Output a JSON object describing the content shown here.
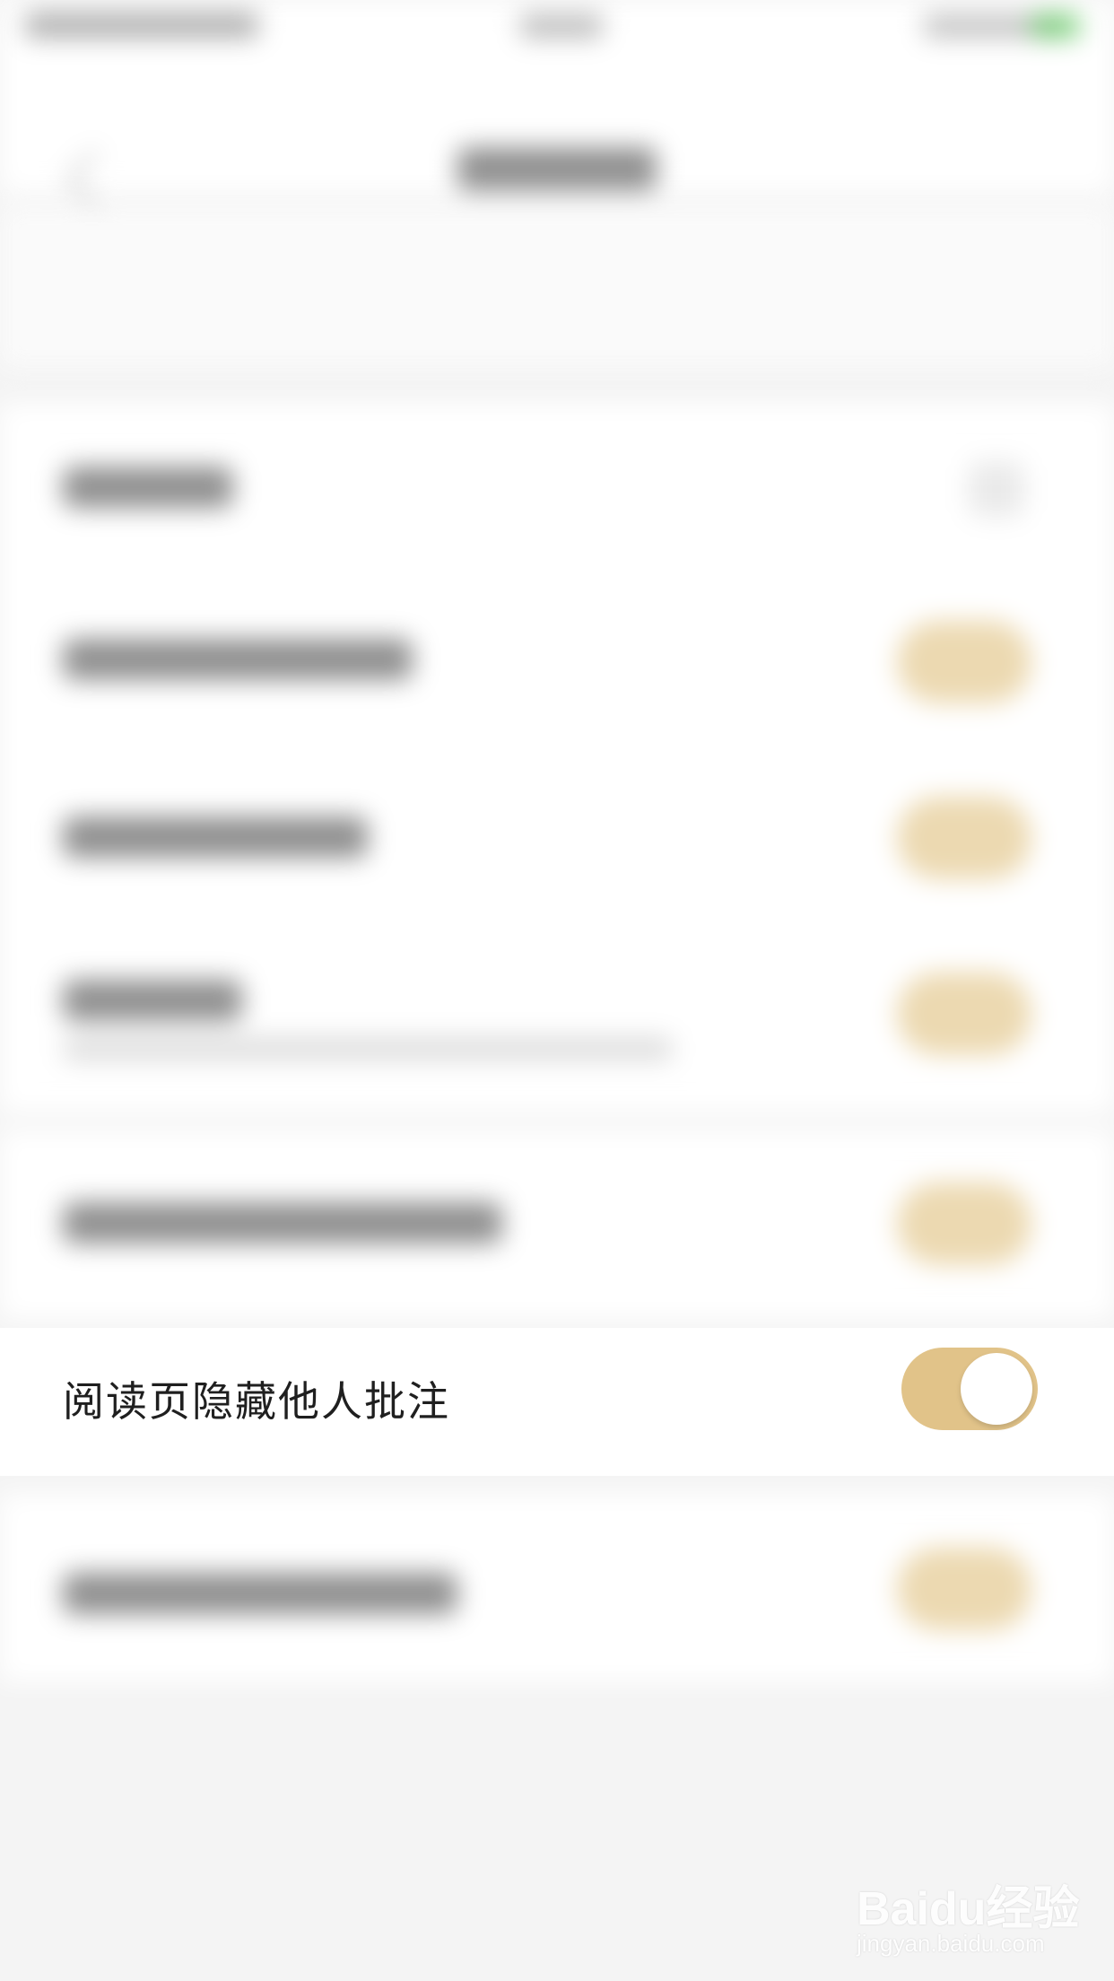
{
  "colors": {
    "accent_toggle_on": "#e1c389",
    "background": "#f4f4f4",
    "row_background": "#ffffff",
    "label_text": "#1f1f1f"
  },
  "focused_setting": {
    "label": "阅读页隐藏他人批注",
    "toggle_state": "on"
  },
  "blurred_settings": {
    "note": "",
    "toggle_states": [
      "on",
      "on",
      "on",
      "on",
      "on"
    ]
  },
  "watermark": {
    "brand": "Baidu经验",
    "url": "jingyan.baidu.com"
  },
  "icons": {
    "back": "back-chevron-icon",
    "toggle": "toggle-switch-icon"
  }
}
